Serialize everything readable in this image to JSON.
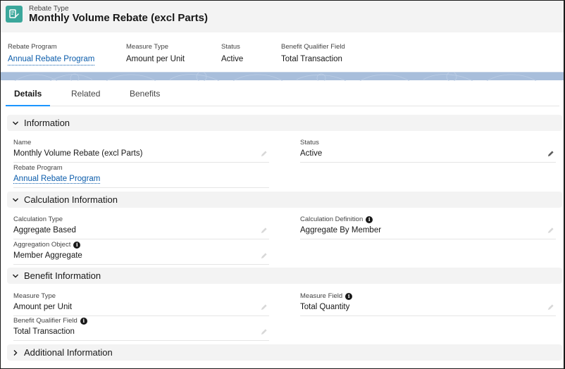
{
  "header": {
    "object_type": "Rebate Type",
    "title": "Monthly Volume Rebate (excl Parts)",
    "icon": "rebate-type-icon"
  },
  "highlights": [
    {
      "label": "Rebate Program",
      "value": "Annual Rebate Program",
      "is_link": true
    },
    {
      "label": "Measure Type",
      "value": "Amount per Unit",
      "is_link": false
    },
    {
      "label": "Status",
      "value": "Active",
      "is_link": false
    },
    {
      "label": "Benefit Qualifier Field",
      "value": "Total Transaction",
      "is_link": false
    }
  ],
  "tabs": [
    {
      "label": "Details",
      "active": true
    },
    {
      "label": "Related",
      "active": false
    },
    {
      "label": "Benefits",
      "active": false
    }
  ],
  "sections": {
    "information": {
      "title": "Information",
      "expanded": true,
      "fields": {
        "name": {
          "label": "Name",
          "value": "Monthly Volume Rebate (excl Parts)"
        },
        "status": {
          "label": "Status",
          "value": "Active"
        },
        "rebate_program": {
          "label": "Rebate Program",
          "value": "Annual Rebate Program"
        }
      }
    },
    "calculation": {
      "title": "Calculation Information",
      "expanded": true,
      "fields": {
        "calculation_type": {
          "label": "Calculation Type",
          "value": "Aggregate Based"
        },
        "calculation_definition": {
          "label": "Calculation Definition",
          "value": "Aggregate By Member"
        },
        "aggregation_object": {
          "label": "Aggregation Object",
          "value": "Member Aggregate"
        }
      }
    },
    "benefit": {
      "title": "Benefit Information",
      "expanded": true,
      "fields": {
        "measure_type": {
          "label": "Measure Type",
          "value": "Amount per Unit"
        },
        "measure_field": {
          "label": "Measure Field",
          "value": "Total Quantity"
        },
        "benefit_qualifier_field": {
          "label": "Benefit Qualifier Field",
          "value": "Total Transaction"
        }
      }
    },
    "additional": {
      "title": "Additional Information",
      "expanded": false
    }
  },
  "colors": {
    "brand_icon": "#3ba79b",
    "link": "#0b5cab",
    "tab_active_underline": "#1b96ff",
    "band": "#a8bedb"
  }
}
